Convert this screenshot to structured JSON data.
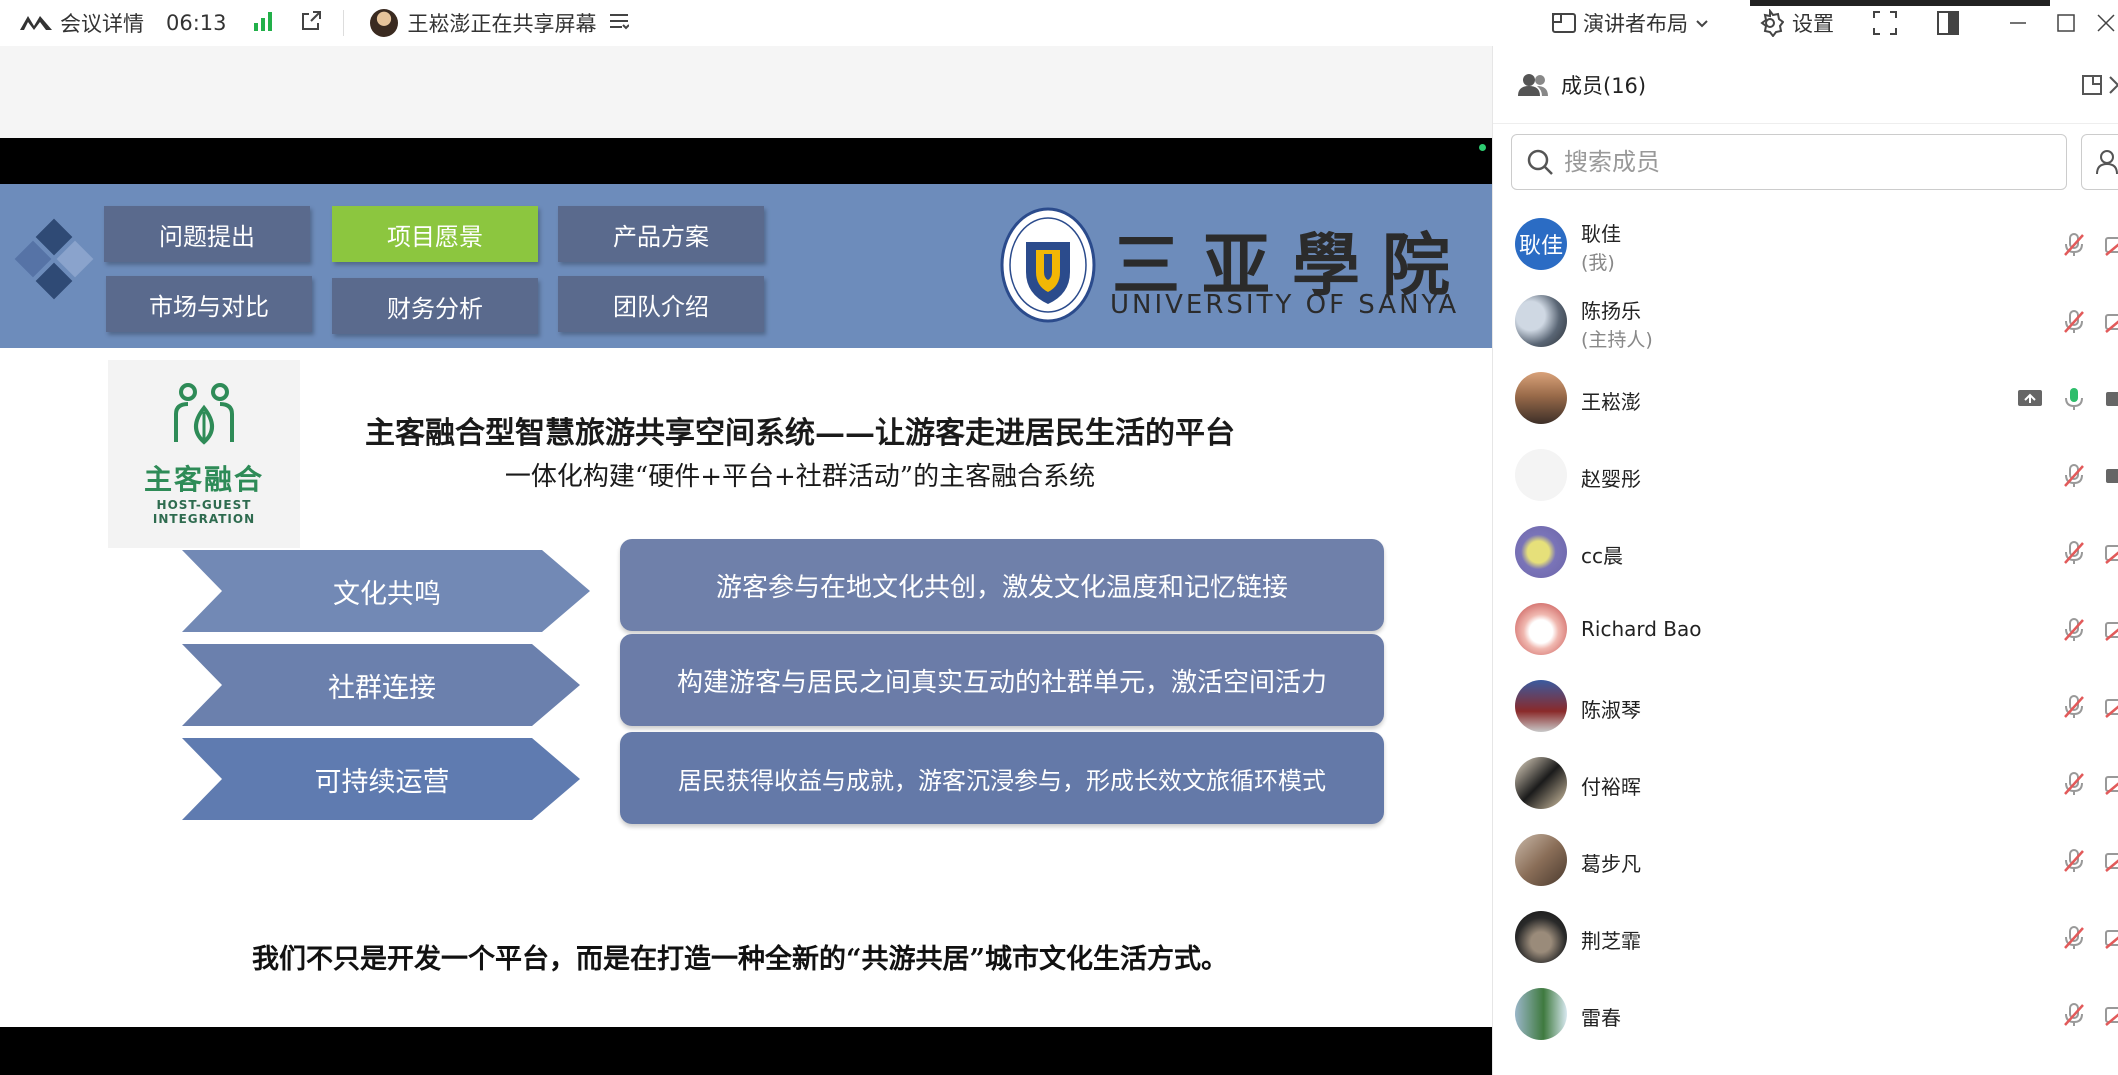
{
  "topbar": {
    "meeting_details": "会议详情",
    "time": "06:13",
    "sharing_text": "王崧澎正在共享屏幕",
    "layout_label": "演讲者布局",
    "settings_label": "设置"
  },
  "slide": {
    "nav_buttons": [
      "问题提出",
      "项目愿景",
      "产品方案",
      "市场与对比",
      "财务分析",
      "团队介绍"
    ],
    "active_nav": "项目愿景",
    "university_cn": "三亚學院",
    "university_en": "UNIVERSITY OF SANYA",
    "logo_cn": "主客融合",
    "logo_en_line1": "HOST-GUEST",
    "logo_en_line2": "INTEGRATION",
    "title": "主客融合型智慧旅游共享空间系统——让游客走进居民生活的平台",
    "subtitle": "一体化构建“硬件+平台+社群活动”的主客融合系统",
    "rows": [
      {
        "label": "文化共鸣",
        "desc": "游客参与在地文化共创，激发文化温度和记忆链接"
      },
      {
        "label": "社群连接",
        "desc": "构建游客与居民之间真实互动的社群单元，激活空间活力"
      },
      {
        "label": "可持续运营",
        "desc": "居民获得收益与成就，游客沉浸参与，形成长效文旅循环模式"
      }
    ],
    "tagline": "我们不只是开发一个平台，而是在打造一种全新的“共游共居”城市文化生活方式。",
    "colors": {
      "band": "#6d8cbb",
      "nav": "#5a6a8d",
      "active": "#8cc63f",
      "pill": "#6f80aa",
      "chevron": "#7289b5"
    }
  },
  "panel": {
    "title": "成员(16)",
    "search_placeholder": "搜索成员",
    "members": [
      {
        "name": "耿佳",
        "role": "(我)",
        "avatar_text": "耿佳",
        "mic": "muted",
        "cam": "off"
      },
      {
        "name": "陈扬乐",
        "role": "(主持人)",
        "avatar_text": "",
        "mic": "muted",
        "cam": "off"
      },
      {
        "name": "王崧澎",
        "role": "",
        "avatar_text": "",
        "mic": "on",
        "cam": "on",
        "sharing": true
      },
      {
        "name": "赵婴彤",
        "role": "",
        "avatar_text": "",
        "mic": "muted",
        "cam": "on"
      },
      {
        "name": "cc晨",
        "role": "",
        "avatar_text": "",
        "mic": "muted",
        "cam": "off"
      },
      {
        "name": "Richard Bao",
        "role": "",
        "avatar_text": "",
        "mic": "muted",
        "cam": "off"
      },
      {
        "name": "陈淑琴",
        "role": "",
        "avatar_text": "",
        "mic": "muted",
        "cam": "off"
      },
      {
        "name": "付裕晖",
        "role": "",
        "avatar_text": "",
        "mic": "muted",
        "cam": "off"
      },
      {
        "name": "葛步凡",
        "role": "",
        "avatar_text": "",
        "mic": "muted",
        "cam": "off"
      },
      {
        "name": "荆芝霏",
        "role": "",
        "avatar_text": "",
        "mic": "muted",
        "cam": "off"
      },
      {
        "name": "雷春",
        "role": "",
        "avatar_text": "",
        "mic": "muted",
        "cam": "off"
      }
    ]
  }
}
